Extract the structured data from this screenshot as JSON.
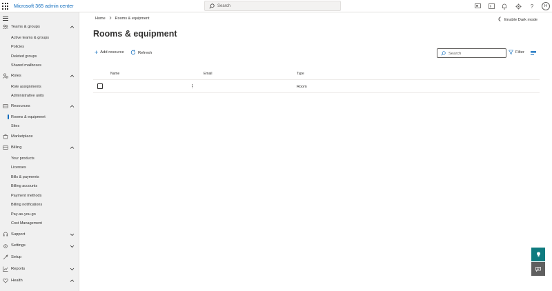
{
  "app": {
    "title": "Microsoft 365 admin center"
  },
  "topbar": {
    "search_placeholder": "Search",
    "avatar_initial": "H",
    "help_glyph": "?"
  },
  "sidebar": {
    "groups": [
      {
        "label": "Teams & groups",
        "icon": "people-icon",
        "expanded": true,
        "items": [
          "Active teams & groups",
          "Policies",
          "Deleted groups",
          "Shared mailboxes"
        ]
      },
      {
        "label": "Roles",
        "icon": "roles-icon",
        "expanded": true,
        "items": [
          "Role assignments",
          "Administrative units"
        ]
      },
      {
        "label": "Resources",
        "icon": "resources-icon",
        "expanded": true,
        "items": [
          "Rooms & equipment",
          "Sites"
        ]
      },
      {
        "label": "Marketplace",
        "icon": "marketplace-icon",
        "expanded": false,
        "items": []
      },
      {
        "label": "Billing",
        "icon": "billing-icon",
        "expanded": true,
        "items": [
          "Your products",
          "Licenses",
          "Bills & payments",
          "Billing accounts",
          "Payment methods",
          "Billing notifications",
          "Pay-as-you-go",
          "Cost Management"
        ]
      },
      {
        "label": "Support",
        "icon": "support-icon",
        "expanded": false,
        "items": []
      },
      {
        "label": "Settings",
        "icon": "settings-icon",
        "expanded": false,
        "items": []
      },
      {
        "label": "Setup",
        "icon": "setup-icon",
        "expanded": false,
        "items": []
      },
      {
        "label": "Reports",
        "icon": "reports-icon",
        "expanded": false,
        "items": []
      },
      {
        "label": "Health",
        "icon": "health-icon",
        "expanded": true,
        "items": []
      }
    ],
    "active_item": "Rooms & equipment"
  },
  "main": {
    "breadcrumb": [
      "Home",
      "Rooms & equipment"
    ],
    "dark_mode_label": "Enable Dark mode",
    "title": "Rooms & equipment",
    "commands": {
      "add": "Add resource",
      "refresh": "Refresh"
    },
    "search_placeholder": "Search",
    "filter_label": "Filter",
    "table": {
      "columns": [
        "Name",
        "Email",
        "Type"
      ],
      "rows": [
        {
          "name": "",
          "email": "",
          "type": "Room"
        }
      ]
    }
  },
  "colors": {
    "accent": "#0f6cbd",
    "sidebar_bg": "#f0f0f0",
    "teal_button": "#0f7b7f",
    "dark_button": "#5f5f5f"
  }
}
